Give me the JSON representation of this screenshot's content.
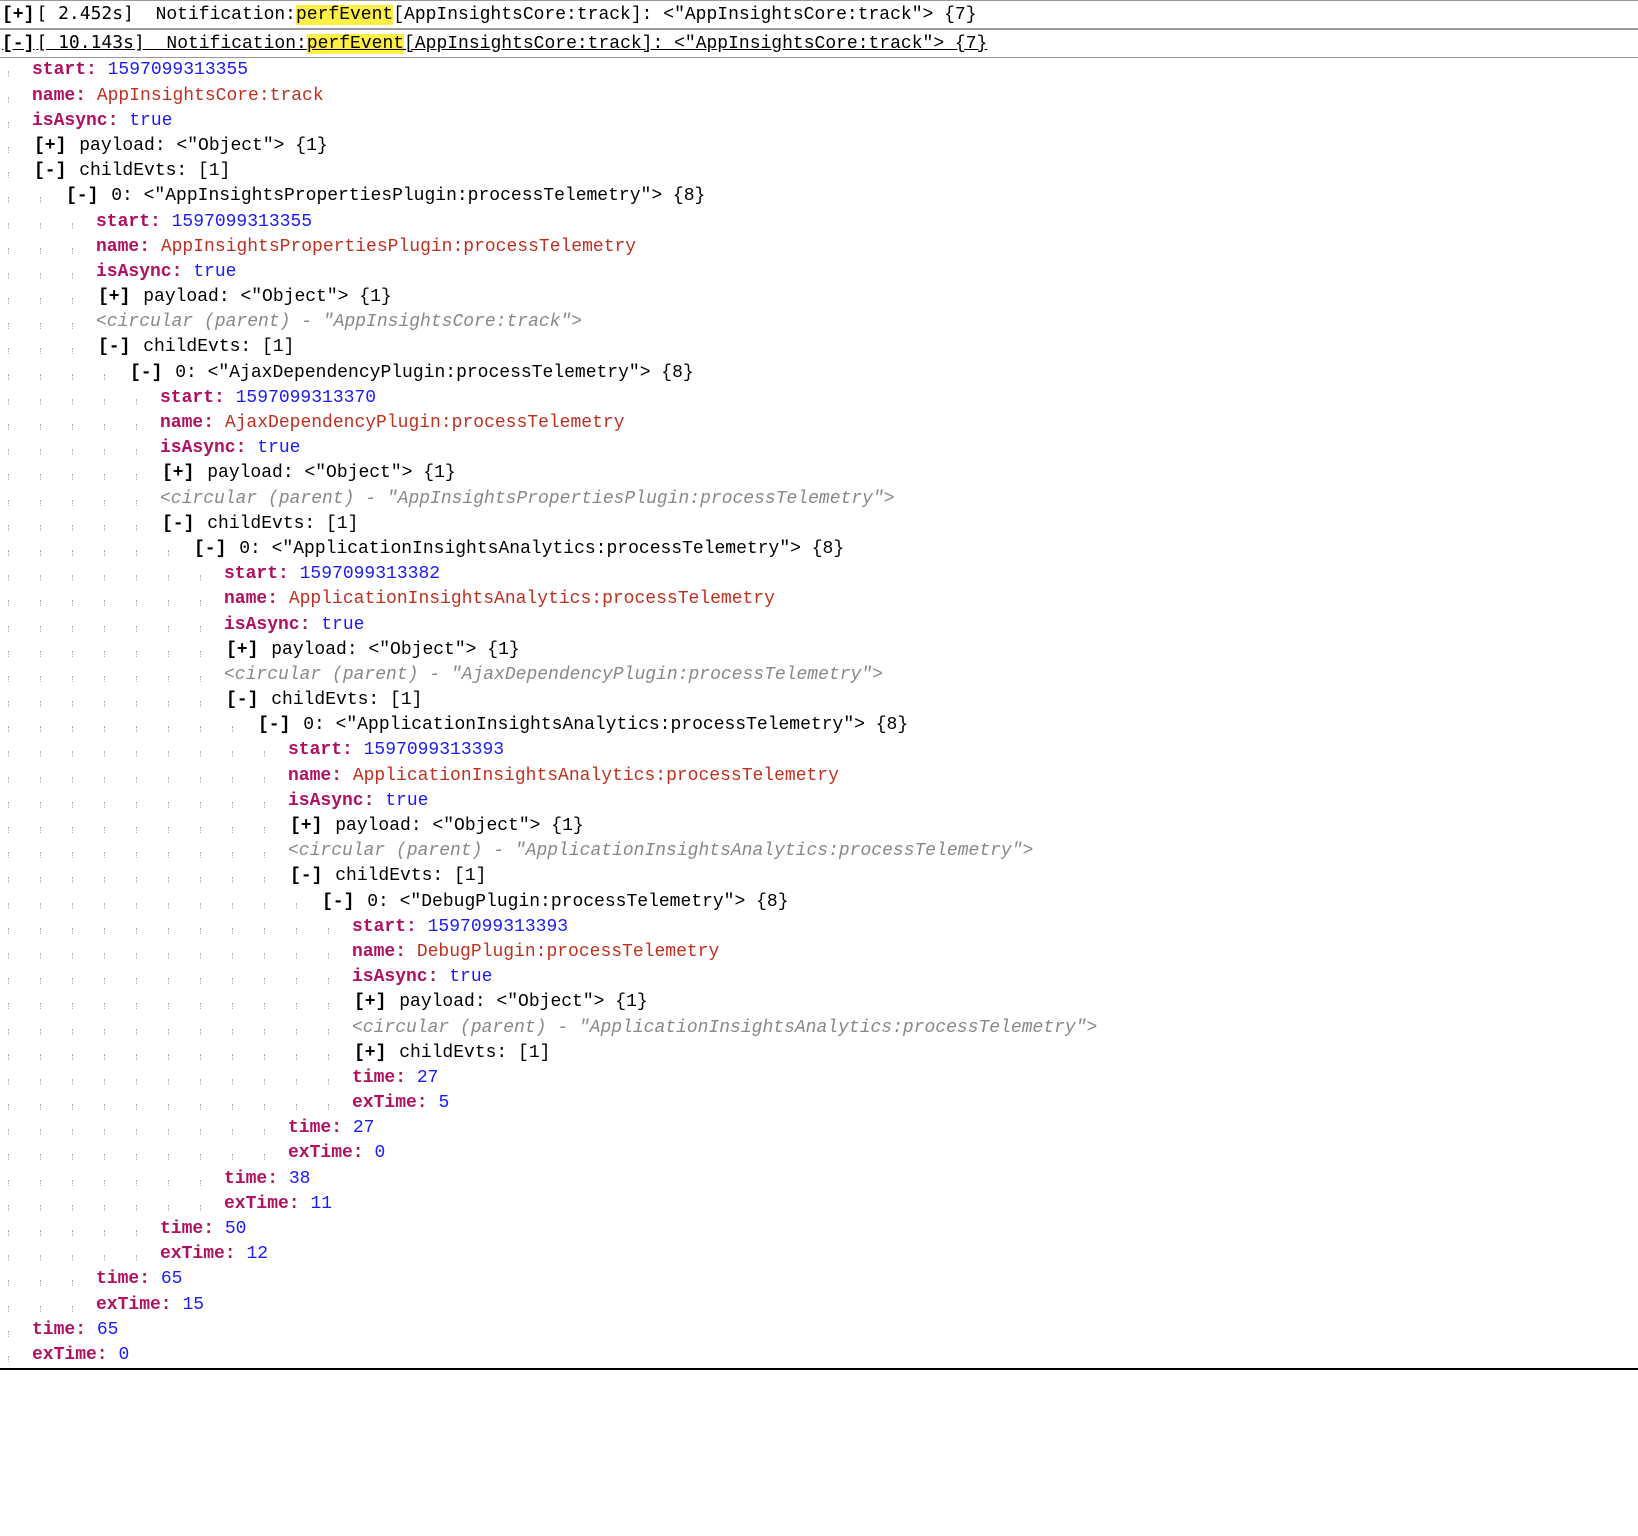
{
  "toggles": {
    "plus": "[+]",
    "minus": "[-]"
  },
  "rows": {
    "r0": {
      "time": "[ 2.452s]",
      "label": "Notification:",
      "hl": "perfEvent",
      "rest": "[AppInsightsCore:track]: <\"AppInsightsCore:track\"> {7}"
    },
    "r1": {
      "time": "[ 10.143s]",
      "label": "Notification:",
      "hl": "perfEvent",
      "rest": "[AppInsightsCore:track]: <\"AppInsightsCore:track\"> {7}"
    }
  },
  "labels": {
    "start": "start:",
    "name": "name:",
    "isAsync": "isAsync:",
    "payload": "payload:",
    "childEvts": "childEvts:",
    "time": "time:",
    "exTime": "exTime:"
  },
  "payloadSuffix": " <\"Object\"> {1}",
  "childEvtsSuffix": " [1]",
  "trueVal": "true",
  "item0": "0:",
  "root": {
    "start": "1597099313355",
    "name": "AppInsightsCore:track",
    "time": "65",
    "exTime": "0",
    "child0Header": " <\"AppInsightsPropertiesPlugin:processTelemetry\"> {8}"
  },
  "l1": {
    "start": "1597099313355",
    "name": "AppInsightsPropertiesPlugin:processTelemetry",
    "circular": "<circular (parent) - \"AppInsightsCore:track\">",
    "time": "65",
    "exTime": "15",
    "child0Header": " <\"AjaxDependencyPlugin:processTelemetry\"> {8}"
  },
  "l2": {
    "start": "1597099313370",
    "name": "AjaxDependencyPlugin:processTelemetry",
    "circular": "<circular (parent) - \"AppInsightsPropertiesPlugin:processTelemetry\">",
    "time": "50",
    "exTime": "12",
    "child0Header": " <\"ApplicationInsightsAnalytics:processTelemetry\"> {8}"
  },
  "l3": {
    "start": "1597099313382",
    "name": "ApplicationInsightsAnalytics:processTelemetry",
    "circular": "<circular (parent) - \"AjaxDependencyPlugin:processTelemetry\">",
    "time": "38",
    "exTime": "11",
    "child0Header": " <\"ApplicationInsightsAnalytics:processTelemetry\"> {8}"
  },
  "l4": {
    "start": "1597099313393",
    "name": "ApplicationInsightsAnalytics:processTelemetry",
    "circular": "<circular (parent) - \"ApplicationInsightsAnalytics:processTelemetry\">",
    "time": "27",
    "exTime": "0",
    "child0Header": " <\"DebugPlugin:processTelemetry\"> {8}"
  },
  "l5": {
    "start": "1597099313393",
    "name": "DebugPlugin:processTelemetry",
    "circular": "<circular (parent) - \"ApplicationInsightsAnalytics:processTelemetry\">",
    "time": "27",
    "exTime": "5"
  }
}
